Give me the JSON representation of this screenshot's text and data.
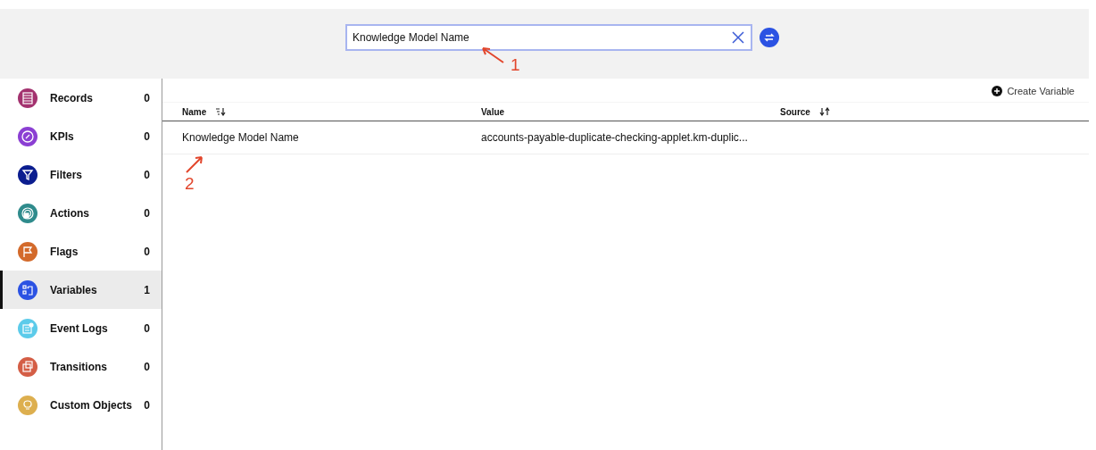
{
  "search": {
    "value": "Knowledge Model Name"
  },
  "sidebar": {
    "items": [
      {
        "kind": "records",
        "label": "Records",
        "count": "0",
        "color": "#a3326f",
        "selected": false
      },
      {
        "kind": "kpis",
        "label": "KPIs",
        "count": "0",
        "color": "#8b3fd3",
        "selected": false
      },
      {
        "kind": "filters",
        "label": "Filters",
        "count": "0",
        "color": "#0b1d8f",
        "selected": false
      },
      {
        "kind": "actions",
        "label": "Actions",
        "count": "0",
        "color": "#2f8b8c",
        "selected": false
      },
      {
        "kind": "flags",
        "label": "Flags",
        "count": "0",
        "color": "#d36a2b",
        "selected": false
      },
      {
        "kind": "variables",
        "label": "Variables",
        "count": "1",
        "color": "#2b52e3",
        "selected": true
      },
      {
        "kind": "eventlogs",
        "label": "Event Logs",
        "count": "0",
        "color": "#5ccbea",
        "selected": false
      },
      {
        "kind": "transitions",
        "label": "Transitions",
        "count": "0",
        "color": "#d45e46",
        "selected": false
      },
      {
        "kind": "custom",
        "label": "Custom Objects",
        "count": "0",
        "color": "#ddaf4f",
        "selected": false
      }
    ]
  },
  "create_button": "Create Variable",
  "table": {
    "columns": [
      {
        "label": "Name",
        "kind": "sortdown"
      },
      {
        "label": "Value",
        "kind": "plain"
      },
      {
        "label": "Source",
        "kind": "sortboth"
      }
    ],
    "rows": [
      [
        "Knowledge Model Name",
        "accounts-payable-duplicate-checking-applet.km-duplic..."
      ]
    ]
  },
  "annotations": [
    {
      "label": "1"
    },
    {
      "label": "2"
    }
  ]
}
